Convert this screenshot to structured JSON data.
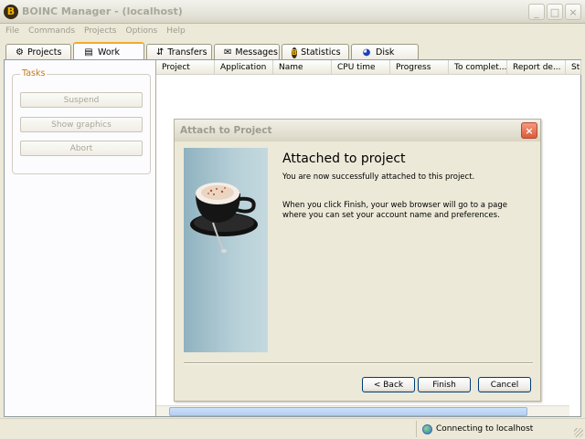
{
  "window": {
    "title": "BOINC Manager - (localhost)",
    "app_icon_glyph": "B",
    "controls": {
      "minimize": "_",
      "maximize": "□",
      "close": "×"
    }
  },
  "menu": [
    "File",
    "Commands",
    "Projects",
    "Options",
    "Help"
  ],
  "tabs": [
    {
      "label": "Projects",
      "icon": "gear-icon",
      "glyph": "⚙"
    },
    {
      "label": "Work",
      "icon": "list-icon",
      "glyph": "▤",
      "active": true
    },
    {
      "label": "Transfers",
      "icon": "transfer-icon",
      "glyph": "⇵"
    },
    {
      "label": "Messages",
      "icon": "envelope-icon",
      "glyph": "✉"
    },
    {
      "label": "Statistics",
      "icon": "boinc-logo-icon",
      "glyph": "B"
    },
    {
      "label": "Disk",
      "icon": "pie-chart-icon",
      "glyph": "◕"
    }
  ],
  "tasks": {
    "label": "Tasks",
    "buttons": [
      "Suspend",
      "Show graphics",
      "Abort"
    ]
  },
  "columns": [
    "Project",
    "Application",
    "Name",
    "CPU time",
    "Progress",
    "To complet...",
    "Report de...",
    "St"
  ],
  "dialog": {
    "title": "Attach to Project",
    "close": "×",
    "heading": "Attached to project",
    "message1": "You are now successfully attached to this project.",
    "message2": "When you click Finish, your web browser will go to a page where you can set your account name and preferences.",
    "buttons": {
      "back": "< Back",
      "finish": "Finish",
      "cancel": "Cancel"
    }
  },
  "status": {
    "text": "Connecting to localhost",
    "icon": "globe-icon"
  },
  "colors": {
    "tab_accent": "#F2A92E",
    "tasks_label": "#C47A1A",
    "dialog_close": "#DD5A3A",
    "button_border": "#003C74"
  }
}
